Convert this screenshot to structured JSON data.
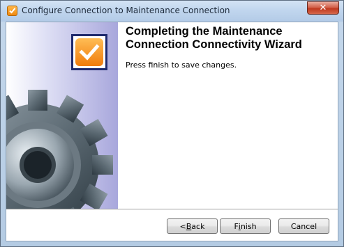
{
  "window": {
    "title": "Configure Connection to Maintenance Connection",
    "close_label": "✕",
    "app_icon": "orange-check-icon"
  },
  "wizard": {
    "heading_line1": "Completing the Maintenance",
    "heading_line2": "Connection Connectivity Wizard",
    "message": "Press finish to save changes.",
    "badge_icon": "orange-check-icon",
    "side_image": "gear-icon"
  },
  "buttons": {
    "back_prefix": "< ",
    "back_hotkey": "B",
    "back_rest": "ack",
    "finish_prefix": "F",
    "finish_hotkey": "i",
    "finish_rest": "nish",
    "cancel": "Cancel"
  },
  "colors": {
    "accent_orange": "#f08a12",
    "badge_border": "#1f2a6d",
    "titlebar": "#c1d6ee"
  }
}
